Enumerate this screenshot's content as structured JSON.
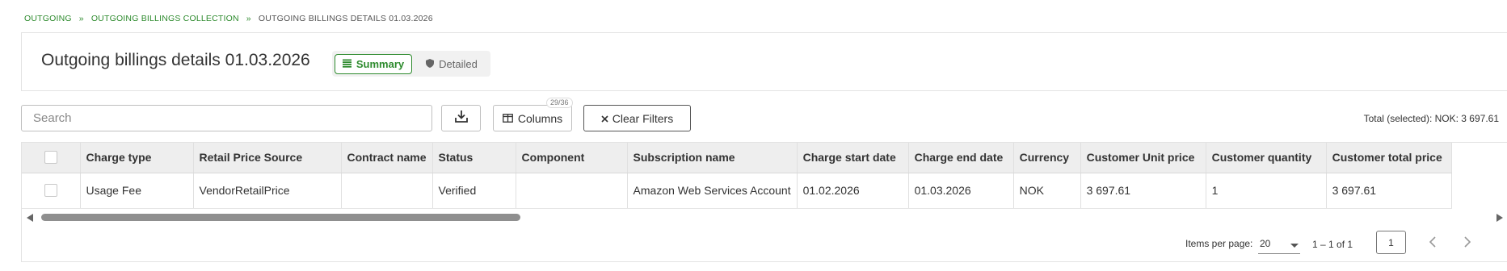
{
  "breadcrumb": {
    "items": [
      "OUTGOING",
      "OUTGOING BILLINGS COLLECTION"
    ],
    "separator": "»",
    "current": "OUTGOING BILLINGS DETAILS 01.03.2026"
  },
  "header": {
    "title": "Outgoing billings details 01.03.2026",
    "summary_label": "Summary",
    "detailed_label": "Detailed"
  },
  "toolbar": {
    "search_placeholder": "Search",
    "columns_label": "Columns",
    "columns_badge": "29/36",
    "clear_filters_label": "Clear Filters",
    "total_selected": "Total (selected):  NOK: 3 697.61"
  },
  "table": {
    "columns": [
      "Charge type",
      "Retail Price Source",
      "Contract name",
      "Status",
      "Component",
      "Subscription name",
      "Charge start date",
      "Charge end date",
      "Currency",
      "Customer Unit price",
      "Customer quantity",
      "Customer total price"
    ],
    "rows": [
      [
        "Usage Fee",
        "VendorRetailPrice",
        "",
        "Verified",
        "",
        "Amazon Web Services Account",
        "01.02.2026",
        "01.03.2026",
        "NOK",
        "3 697.61",
        "1",
        "3 697.61"
      ]
    ]
  },
  "pagination": {
    "items_per_page_label": "Items per page:",
    "items_per_page": "20",
    "range": "1 – 1 of 1",
    "page": "1"
  },
  "colors": {
    "accent": "#2e8b2e",
    "header_bg": "#eeeeee"
  },
  "icons": {
    "summary": "list-icon",
    "detailed": "shield-icon",
    "download": "download-icon",
    "columns": "columns-icon",
    "clear": "close-icon"
  }
}
